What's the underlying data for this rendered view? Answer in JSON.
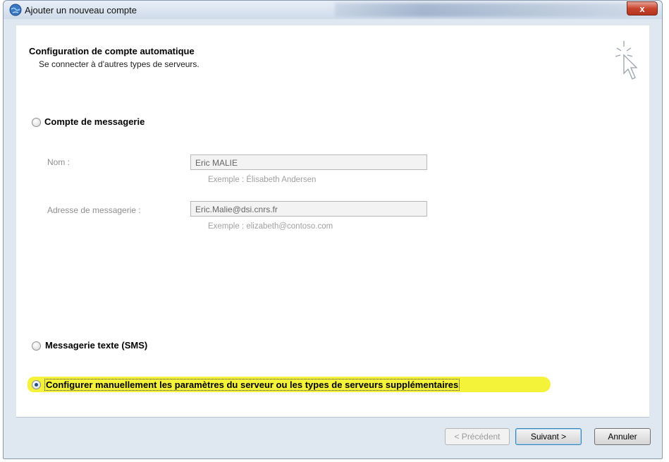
{
  "window": {
    "title": "Ajouter un nouveau compte",
    "close_glyph": "x"
  },
  "header": {
    "title": "Configuration de compte automatique",
    "subtitle": "Se connecter à d'autres types de serveurs."
  },
  "options": {
    "email_account": {
      "label": "Compte de messagerie",
      "selected": false
    },
    "sms": {
      "label": "Messagerie texte (SMS)",
      "selected": false
    },
    "manual": {
      "label": "Configurer manuellement les paramètres du serveur ou les types de serveurs supplémentaires",
      "selected": true
    }
  },
  "fields": {
    "name": {
      "label": "Nom :",
      "value": "Eric MALIE",
      "example": "Exemple : Élisabeth Andersen"
    },
    "email": {
      "label": "Adresse de messagerie :",
      "value": "Eric.Malie@dsi.cnrs.fr",
      "example": "Exemple : elizabeth@contoso.com"
    }
  },
  "buttons": {
    "previous": "< Précédent",
    "next": "Suivant >",
    "cancel": "Annuler"
  },
  "colors": {
    "highlight": "#f5f23a",
    "close_red": "#c8452d",
    "frame": "#dfe7f1"
  },
  "icons": {
    "app": "outlook-globe-icon",
    "wizard": "cursor-sparkle-icon"
  }
}
